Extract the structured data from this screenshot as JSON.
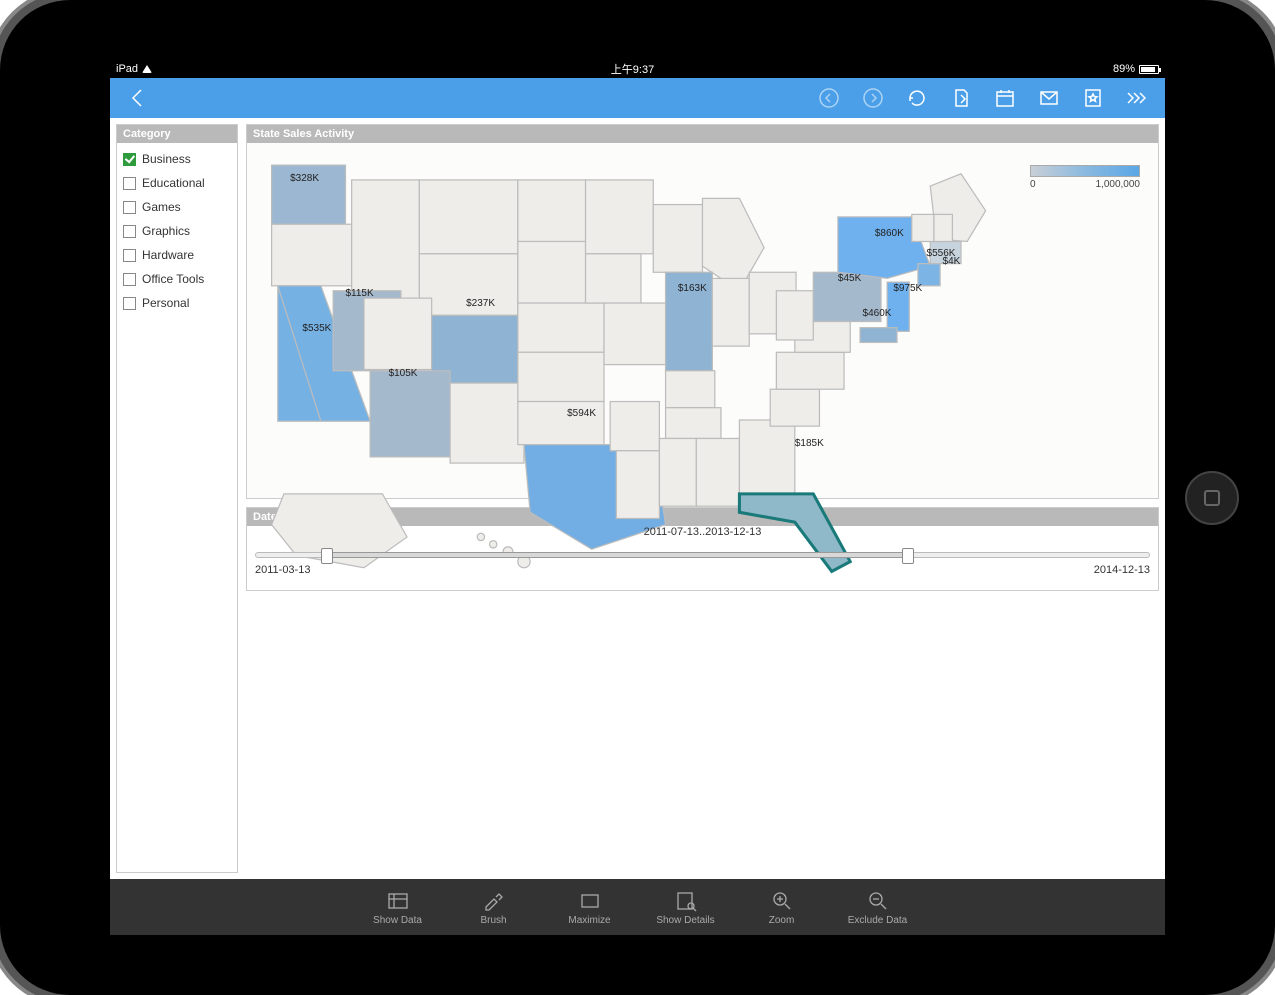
{
  "device": {
    "name": "iPad",
    "time": "上午9:37",
    "battery_pct": "89%"
  },
  "toolbar_top_icons": [
    "back-icon",
    "nav-prev-icon",
    "nav-next-icon",
    "refresh-icon",
    "export-icon",
    "calendar-icon",
    "email-icon",
    "bookmark-icon",
    "more-icon"
  ],
  "sidebar": {
    "title": "Category",
    "items": [
      {
        "label": "Business",
        "checked": true
      },
      {
        "label": "Educational",
        "checked": false
      },
      {
        "label": "Games",
        "checked": false
      },
      {
        "label": "Graphics",
        "checked": false
      },
      {
        "label": "Hardware",
        "checked": false
      },
      {
        "label": "Office Tools",
        "checked": false
      },
      {
        "label": "Personal",
        "checked": false
      }
    ]
  },
  "map_panel": {
    "title": "State Sales Activity",
    "legend_min": "0",
    "legend_max": "1,000,000",
    "values": {
      "WA": "$328K",
      "CA": "$535K",
      "NV": "$115K",
      "AZ": "$105K",
      "CO": "$237K",
      "TX": "$594K",
      "IL": "$163K",
      "FL": "$185K",
      "NY": "$860K",
      "PA": "$45K",
      "NJ": "$975K",
      "MD": "$460K",
      "CT": "$556K",
      "MA": "$4K"
    }
  },
  "date_panel": {
    "title": "Date Range Selecter",
    "start": "2011-03-13",
    "end": "2014-12-13",
    "range_label": "2011-07-13..2013-12-13",
    "sel_from_pct": 8,
    "sel_to_pct": 73
  },
  "bottom_toolbar": [
    {
      "icon": "data-icon",
      "label": "Show Data"
    },
    {
      "icon": "brush-icon",
      "label": "Brush"
    },
    {
      "icon": "maximize-icon",
      "label": "Maximize"
    },
    {
      "icon": "details-icon",
      "label": "Show Details"
    },
    {
      "icon": "zoom-in-icon",
      "label": "Zoom"
    },
    {
      "icon": "exclude-icon",
      "label": "Exclude Data"
    }
  ],
  "chart_data": {
    "type": "heatmap",
    "title": "State Sales Activity",
    "color_scale": {
      "min": 0,
      "max": 1000000,
      "unit": "USD"
    },
    "series": [
      {
        "state": "WA",
        "value": 328000
      },
      {
        "state": "CA",
        "value": 535000
      },
      {
        "state": "NV",
        "value": 115000
      },
      {
        "state": "AZ",
        "value": 105000
      },
      {
        "state": "CO",
        "value": 237000
      },
      {
        "state": "TX",
        "value": 594000
      },
      {
        "state": "IL",
        "value": 163000
      },
      {
        "state": "FL",
        "value": 185000
      },
      {
        "state": "NY",
        "value": 860000
      },
      {
        "state": "PA",
        "value": 45000
      },
      {
        "state": "NJ",
        "value": 975000
      },
      {
        "state": "MD",
        "value": 460000
      },
      {
        "state": "CT",
        "value": 556000
      },
      {
        "state": "MA",
        "value": 4000
      }
    ]
  }
}
